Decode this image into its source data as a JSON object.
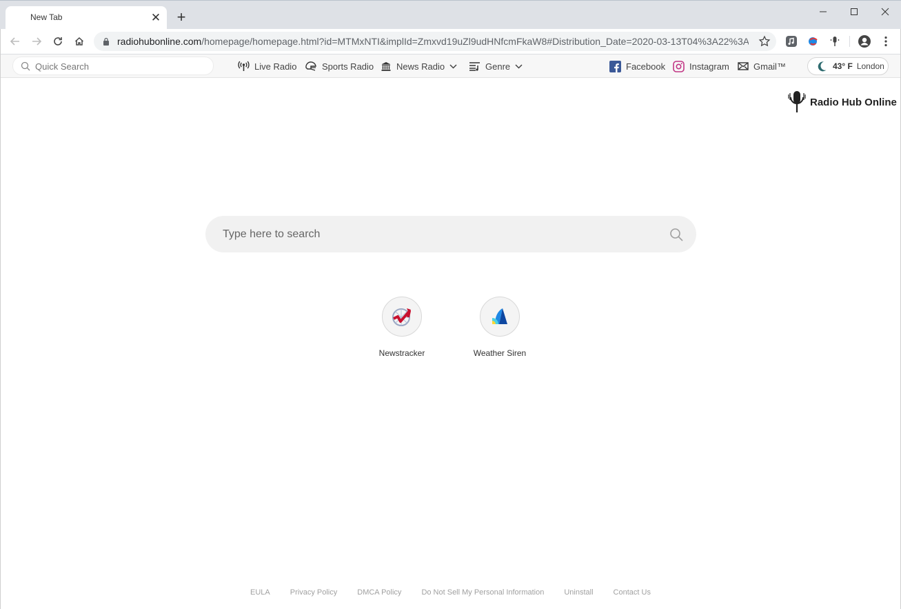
{
  "browser": {
    "tab_title": "New Tab",
    "url_domain": "radiohubonline.com",
    "url_path": "/homepage/homepage.html?id=MTMxNTI&implId=Zmxvd19uZl9udHNfcmFkaW8#Distribution_Date=2020-03-13T04%3A22%3A5..."
  },
  "sitebar": {
    "quick_search_placeholder": "Quick Search",
    "links": {
      "live_radio": "Live Radio",
      "sports_radio": "Sports Radio",
      "news_radio": "News Radio",
      "genre": "Genre",
      "facebook": "Facebook",
      "instagram": "Instagram",
      "gmail": "Gmail™"
    },
    "weather": {
      "temp": "43° F",
      "city": "London"
    }
  },
  "logo": {
    "text": "Radio Hub Online"
  },
  "main_search": {
    "placeholder": "Type here to search"
  },
  "tiles": [
    {
      "label": "Newstracker"
    },
    {
      "label": "Weather Siren"
    }
  ],
  "footer": {
    "links": [
      "EULA",
      "Privacy Policy",
      "DMCA Policy",
      "Do Not Sell My Personal Information",
      "Uninstall",
      "Contact Us"
    ]
  },
  "colors": {
    "facebook": "#3b5998",
    "instagram": "#c13584",
    "newstracker_red": "#c8102e",
    "siren_blue": "#1e88e5",
    "siren_yellow": "#fdd835"
  }
}
